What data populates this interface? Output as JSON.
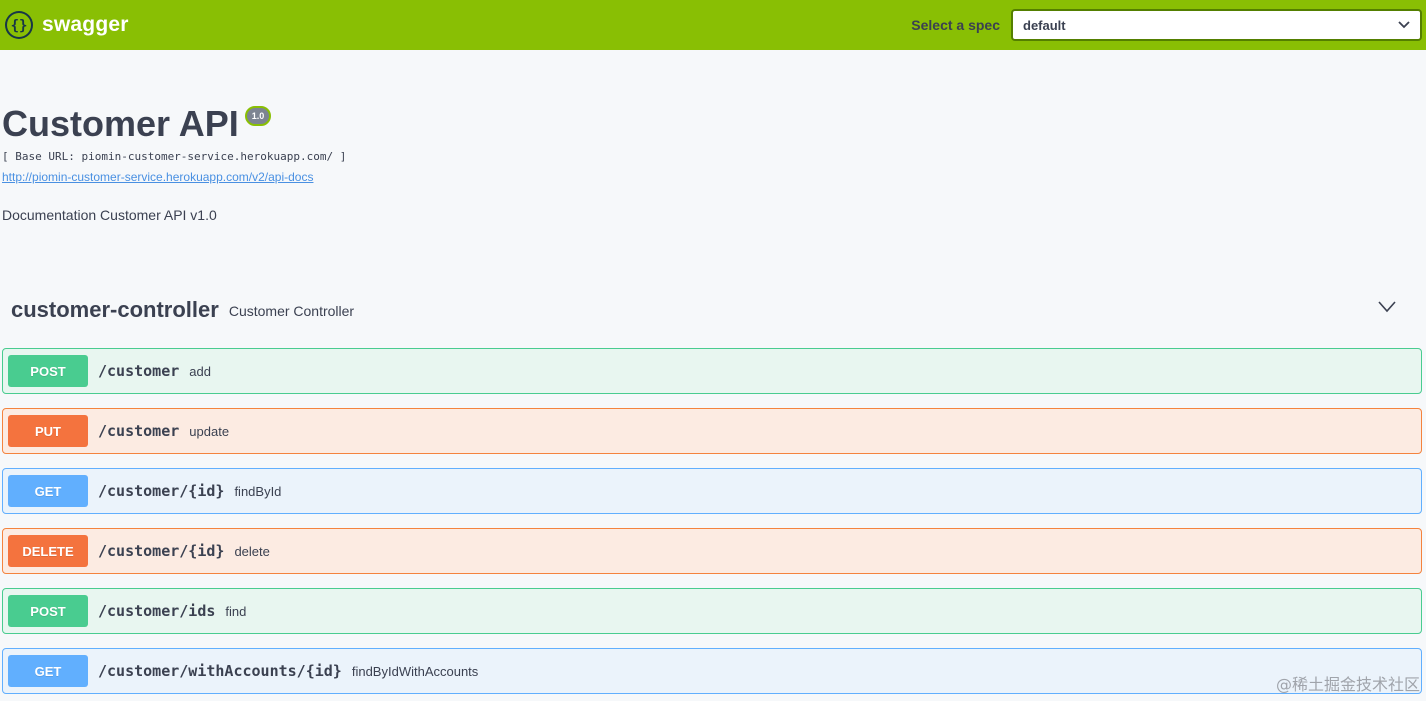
{
  "topbar": {
    "brand": "swagger",
    "spec_label": "Select a spec",
    "spec_value": "default",
    "bg_color": "#89bf04"
  },
  "info": {
    "title": "Customer API",
    "version": "1.0",
    "base_url": "[ Base URL: piomin-customer-service.herokuapp.com/ ]",
    "docs_link": "http://piomin-customer-service.herokuapp.com/v2/api-docs",
    "description": "Documentation Customer API v1.0"
  },
  "tag": {
    "name": "customer-controller",
    "description": "Customer Controller"
  },
  "operations": [
    {
      "method": "POST",
      "path": "/customer",
      "summary": "add"
    },
    {
      "method": "PUT",
      "path": "/customer",
      "summary": "update"
    },
    {
      "method": "GET",
      "path": "/customer/{id}",
      "summary": "findById"
    },
    {
      "method": "DELETE",
      "path": "/customer/{id}",
      "summary": "delete"
    },
    {
      "method": "POST",
      "path": "/customer/ids",
      "summary": "find"
    },
    {
      "method": "GET",
      "path": "/customer/withAccounts/{id}",
      "summary": "findByIdWithAccounts"
    }
  ],
  "watermark": "@稀土掘金技术社区",
  "icons": {
    "logo": "swagger-logo-icon",
    "spec_dropdown": "chevron-down-icon",
    "tag_toggle": "chevron-down-icon"
  }
}
